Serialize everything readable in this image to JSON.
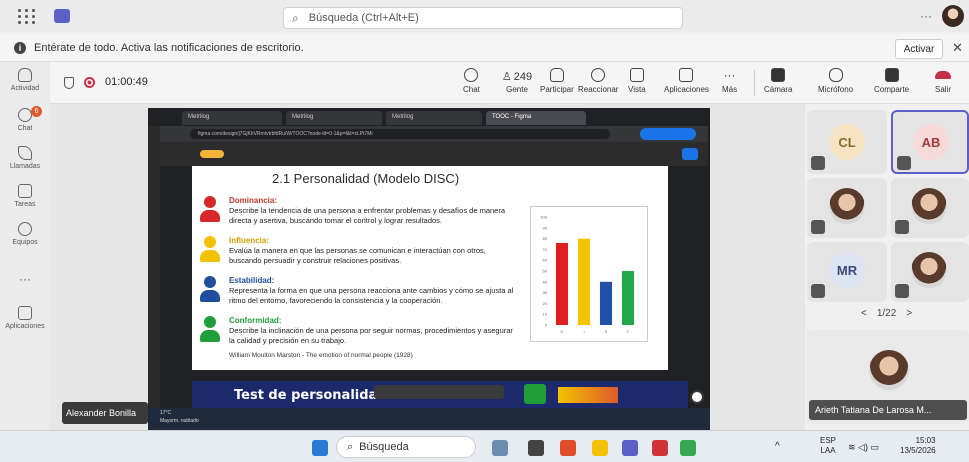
{
  "titlebar": {
    "search_placeholder": "Búsqueda (Ctrl+Alt+E)",
    "more": "···"
  },
  "notification": {
    "text": "Entérate de todo. Activa las notificaciones de escritorio.",
    "button": "Activar",
    "close": "✕"
  },
  "rail": [
    {
      "label": "Actividad"
    },
    {
      "label": "Chat",
      "badge": "6"
    },
    {
      "label": "Llamadas"
    },
    {
      "label": "Tareas"
    },
    {
      "label": "Equipos"
    },
    {
      "label": "···"
    },
    {
      "label": "Aplicaciones"
    }
  ],
  "call": {
    "timer": "01:00:49",
    "participants_count": "249",
    "controls": [
      "Chat",
      "Gente",
      "Participar",
      "Reaccionar",
      "Vista",
      "Aplicaciones",
      "Más",
      "Cámara",
      "Micrófono",
      "Comparte",
      "Salir"
    ]
  },
  "browser": {
    "tabs": [
      "Metrilog",
      "Metrilog",
      "Metrilog",
      "TOOC - Figma"
    ],
    "url": "figma.com/design/j7GjKhVRmtvtrbfdRu/W/TOOC?node-id=0-1&p=f&t=zLPt7Mi"
  },
  "slide": {
    "title": "2.1 Personalidad (Modelo DISC)",
    "items": [
      {
        "title": "Dominancia:",
        "desc": "Describe la tendencia de una persona a enfrentar problemas y desafíos de manera directa y asertiva, buscando tomar el control y lograr resultados.",
        "color": "#d62828"
      },
      {
        "title": "Influencia:",
        "desc": "Evalúa la manera en que las personas se comunican e interactúan con otros, buscando persuadir y construir relaciones positivas.",
        "color": "#f2c200"
      },
      {
        "title": "Estabilidad:",
        "desc": "Representa la forma en que una persona reacciona ante cambios y cómo se ajusta al ritmo del entorno, favoreciendo la consistencia y la cooperación.",
        "color": "#1f4e9c"
      },
      {
        "title": "Conformidad:",
        "desc": "Describe la inclinación de una persona por seguir normas, procedimientos y asegurar la calidad y precisión en su trabajo.",
        "color": "#1f9e3a"
      }
    ],
    "citation": "William Moulton Marston - The emotion of normal people (1928)",
    "banner": "Test de personalida"
  },
  "chart_data": {
    "type": "bar",
    "categories": [
      "D",
      "I",
      "S",
      "C"
    ],
    "values": [
      76,
      80,
      40,
      50
    ],
    "colors": [
      "#e02020",
      "#f5c400",
      "#2250a8",
      "#22a84a"
    ],
    "ylim": [
      0,
      100
    ],
    "yticks": [
      0,
      10,
      20,
      30,
      40,
      50,
      60,
      70,
      80,
      90,
      100
    ]
  },
  "participants": {
    "tiles": [
      {
        "initials": "CL",
        "color": "#f6e3c1",
        "text_color": "#8a6a2a"
      },
      {
        "initials": "AB",
        "color": "#f8d9d9",
        "text_color": "#a23a3a"
      },
      {
        "initials": "MR",
        "color": "#dce3f3",
        "text_color": "#3a4a7a"
      }
    ],
    "pager": "1/22",
    "featured_name": "Arieth Tatiana De Larosa M...",
    "presenter_name": "Alexander Bonilla"
  },
  "taskbar": {
    "search": "Búsqueda",
    "lang": "ESP",
    "lang2": "LAA",
    "time": "15:03",
    "date": "13/5/2026",
    "weather_temp": "17°C",
    "weather_desc": "Mayorm. nublado"
  }
}
